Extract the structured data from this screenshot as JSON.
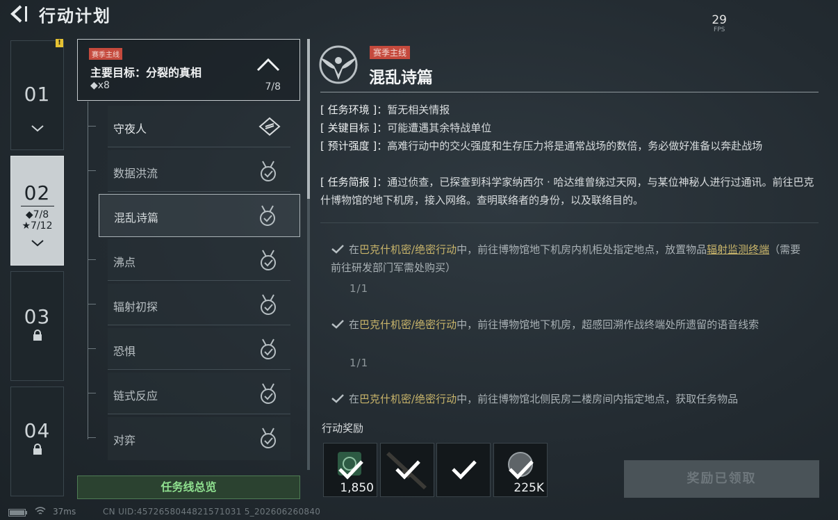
{
  "header": {
    "title": "行动计划",
    "fps_value": "29",
    "fps_label": "FPS"
  },
  "chapters": [
    {
      "number": "01",
      "state": "completed",
      "badge": "!"
    },
    {
      "number": "02",
      "state": "active",
      "diamond_progress": "◆7/8",
      "star_progress": "★7/12"
    },
    {
      "number": "03",
      "state": "locked"
    },
    {
      "number": "04",
      "state": "locked"
    }
  ],
  "main_objective": {
    "tag": "赛季主线",
    "title": "主要目标：分裂的真相",
    "count": "◆x8",
    "progress": "7/8"
  },
  "quests": [
    {
      "label": "守夜人",
      "icon": "diamond-icon"
    },
    {
      "label": "数据洪流",
      "icon": "medal-check-icon"
    },
    {
      "label": "混乱诗篇",
      "icon": "medal-check-icon",
      "selected": true
    },
    {
      "label": "沸点",
      "icon": "medal-check-icon"
    },
    {
      "label": "辐射初探",
      "icon": "medal-check-icon"
    },
    {
      "label": "恐惧",
      "icon": "medal-check-icon"
    },
    {
      "label": "链式反应",
      "icon": "medal-check-icon"
    },
    {
      "label": "对弈",
      "icon": "medal-check-icon"
    }
  ],
  "overview_button": "任务线总览",
  "detail": {
    "tag": "赛季主线",
    "title": "混乱诗篇",
    "info": [
      {
        "key": "[ 任务环境 ]：",
        "value": "暂无相关情报"
      },
      {
        "key": "[ 关键目标 ]：",
        "value": "可能遭遇其余特战单位"
      },
      {
        "key": "[ 预计强度 ]：",
        "value": "高难行动中的交火强度和生存压力将是通常战场的数倍，务必做好准备以奔赴战场"
      },
      {
        "key": "[ 任务简报 ]：",
        "value": "通过侦查，已探查到科学家纳西尔 · 哈达维曾绕过天网，与某位神秘人进行过通讯。前往巴克什博物馆的地下机房，接入网络。查明联络者的身份，以及联络目的。"
      }
    ],
    "tasks": [
      {
        "prefix": "在",
        "location": "巴克什机密/绝密行动",
        "text": "中，前往博物馆地下机房内机柜处指定地点，放置物品",
        "item": "辐射监测终端",
        "suffix": "（需要前往研发部门军需处购买）",
        "progress": "1/1"
      },
      {
        "prefix": "在",
        "location": "巴克什机密/绝密行动",
        "text": "中，前往博物馆地下机房，超感回溯作战终端处所遗留的语音线索",
        "progress": "1/1"
      },
      {
        "prefix": "在",
        "location": "巴克什机密/绝密行动",
        "text": "中，前往博物馆北侧民房二楼房间内指定地点，获取任务物品"
      }
    ],
    "rewards_label": "行动奖励",
    "rewards": [
      {
        "icon": "currency-icon",
        "quantity": "1,850",
        "claimed": true
      },
      {
        "icon": "rifle-icon",
        "quantity": "",
        "claimed": true
      },
      {
        "icon": "blank-icon",
        "quantity": "",
        "claimed": true
      },
      {
        "icon": "coin-icon",
        "quantity": "225K",
        "claimed": true
      }
    ],
    "claimed_button": "奖励已领取"
  },
  "footer": {
    "ping": "37ms",
    "uid": "CN UID:4572658044821571031 5_202606260840"
  },
  "colors": {
    "accent_green": "#8fe08f",
    "tag_red": "#c54a3d",
    "location_gold": "#c8b46a"
  }
}
